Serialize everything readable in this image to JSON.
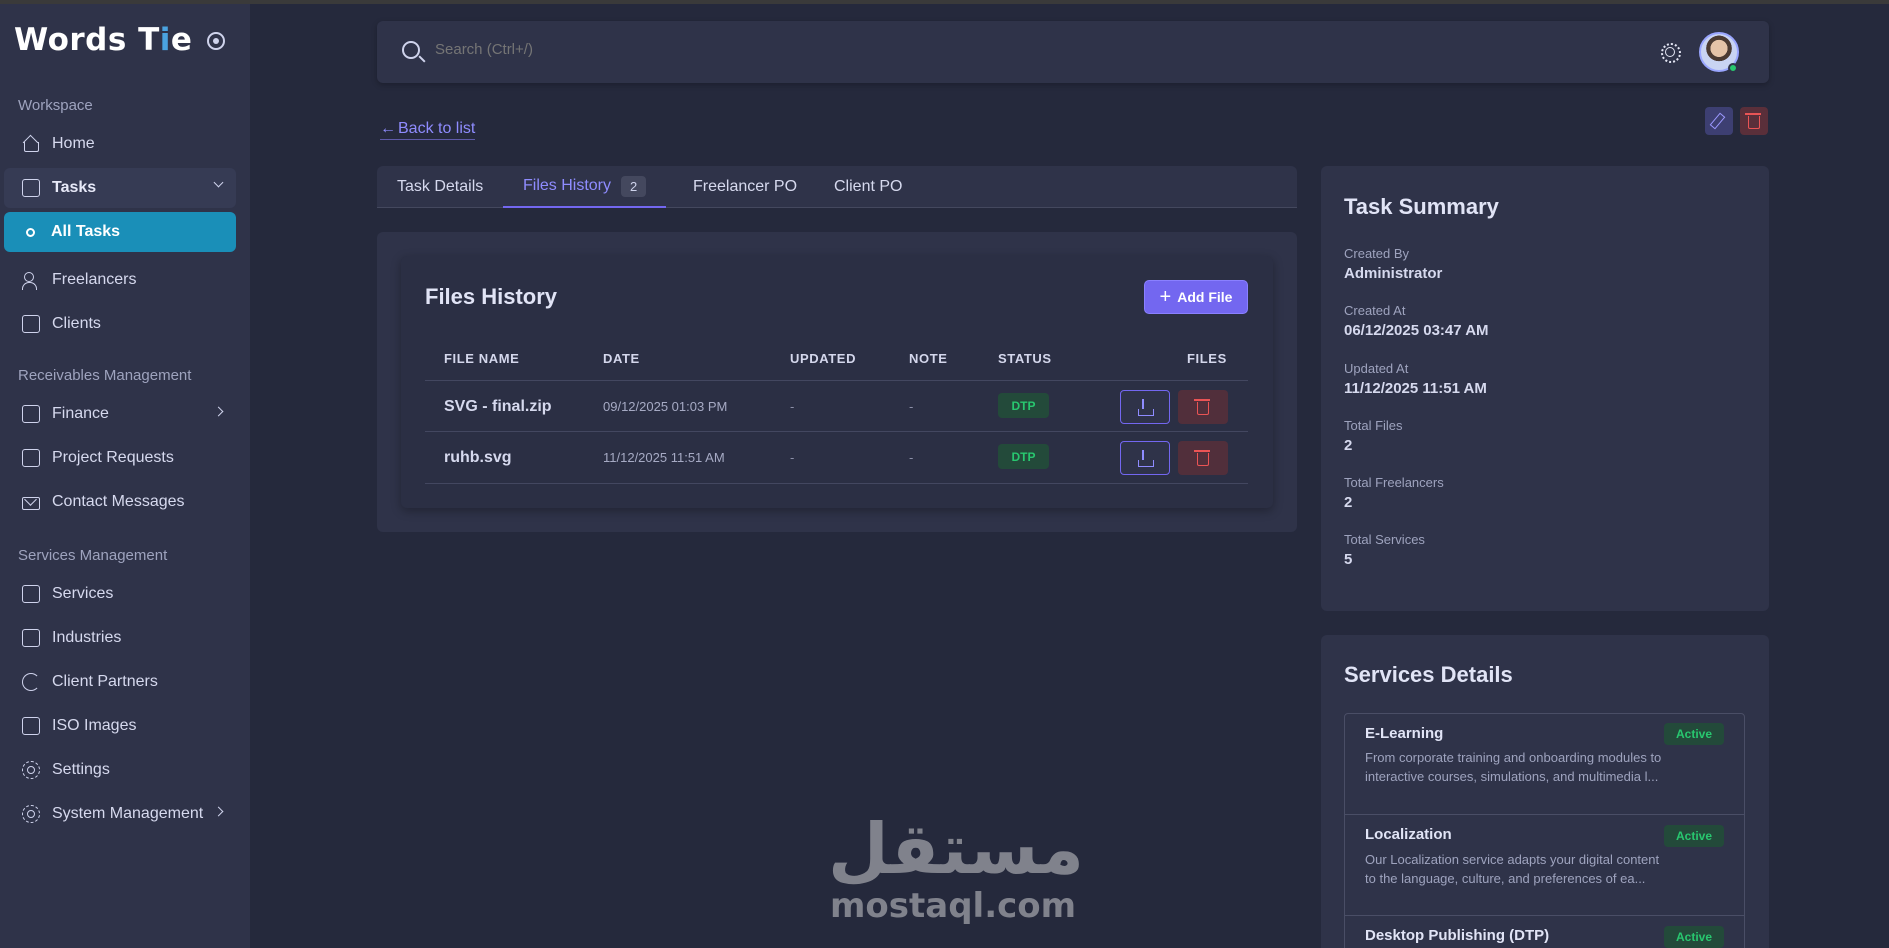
{
  "brand": {
    "name_pre": "Words T",
    "name_i": "i",
    "name_post": "e"
  },
  "sidebar": {
    "section_workspace": "Workspace",
    "home": "Home",
    "tasks": "Tasks",
    "all_tasks": "All Tasks",
    "freelancers": "Freelancers",
    "clients": "Clients",
    "section_receivables": "Receivables Management",
    "finance": "Finance",
    "project_requests": "Project Requests",
    "contact_messages": "Contact Messages",
    "section_services": "Services Management",
    "services": "Services",
    "industries": "Industries",
    "client_partners": "Client Partners",
    "iso_images": "ISO Images",
    "settings": "Settings",
    "system_management": "System Management"
  },
  "search": {
    "placeholder": "Search (Ctrl+/)"
  },
  "back_link": "Back to list",
  "tabs": {
    "task_details": "Task Details",
    "files_history": "Files History",
    "files_history_count": "2",
    "freelancer_po": "Freelancer PO",
    "client_po": "Client PO"
  },
  "files": {
    "title": "Files History",
    "add_button": "Add File",
    "headers": {
      "file_name": "FILE NAME",
      "date": "DATE",
      "updated": "UPDATED",
      "note": "NOTE",
      "status": "STATUS",
      "files": "FILES"
    },
    "rows": [
      {
        "name": "SVG - final.zip",
        "date": "09/12/2025 01:03 PM",
        "updated": "-",
        "note": "-",
        "status": "DTP"
      },
      {
        "name": "ruhb.svg",
        "date": "11/12/2025 11:51 AM",
        "updated": "-",
        "note": "-",
        "status": "DTP"
      }
    ]
  },
  "summary": {
    "title": "Task Summary",
    "created_by_label": "Created By",
    "created_by": "Administrator",
    "created_at_label": "Created At",
    "created_at": "06/12/2025 03:47 AM",
    "updated_at_label": "Updated At",
    "updated_at": "11/12/2025 11:51 AM",
    "total_files_label": "Total Files",
    "total_files": "2",
    "total_freelancers_label": "Total Freelancers",
    "total_freelancers": "2",
    "total_services_label": "Total Services",
    "total_services": "5"
  },
  "services_details": {
    "title": "Services Details",
    "items": [
      {
        "name": "E-Learning",
        "desc": "From corporate training and onboarding modules to interactive courses, simulations, and multimedia l...",
        "status": "Active"
      },
      {
        "name": "Localization",
        "desc": "Our Localization service adapts your digital content to the language, culture, and preferences of ea...",
        "status": "Active"
      },
      {
        "name": "Desktop Publishing (DTP)",
        "desc": "",
        "status": "Active"
      }
    ]
  },
  "watermark": {
    "arabic": "مستقل",
    "latin": "mostaql.com"
  },
  "colors": {
    "accent": "#7367f0",
    "active_nav": "#1a8fb8",
    "success": "#28c76f",
    "danger": "#ea5455"
  }
}
